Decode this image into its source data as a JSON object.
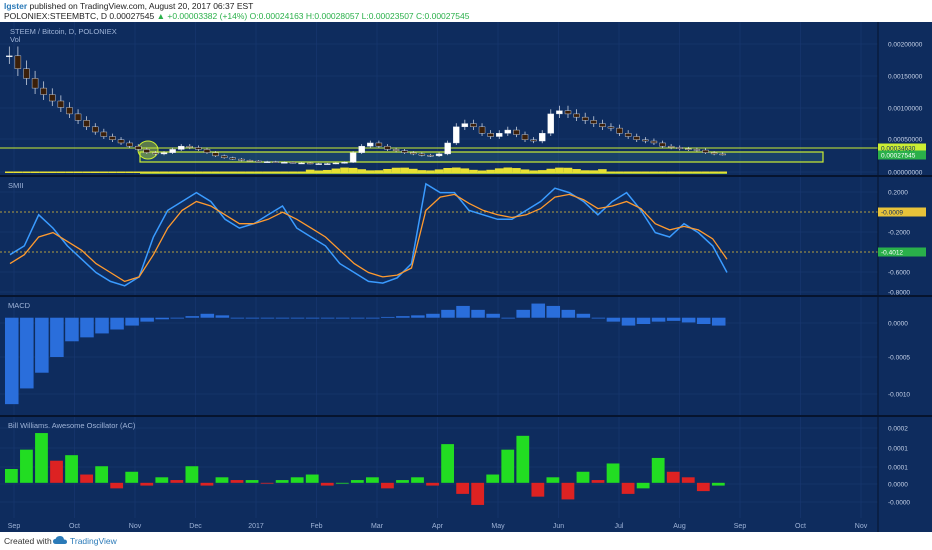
{
  "header": {
    "user": "lgster",
    "published": "published on TradingView.com, August 20, 2017 06:37 EST",
    "symbol_line": "POLONIEX:STEEMBTC, D  0.00027545",
    "change": "▲ +0.00003382 (+14%)",
    "ohlc": "O:0.00024163 H:0.00028057 L:0.00023507 C:0.00027545"
  },
  "footer": {
    "created": "Created with",
    "brand": "TradingView"
  },
  "colors": {
    "background": "#0e2c5e",
    "separator": "#06142e",
    "up": "#ffffff",
    "down": "#3a1f0a",
    "smi": "#3a9bff",
    "signal": "#ff9a2e",
    "macd": "#2a6edb",
    "ao_up": "#22dd22",
    "ao_down": "#dd2222",
    "highlight": "#ccee33",
    "volume": "#e8e033",
    "grid": "#1a3a72"
  },
  "panels": {
    "price": {
      "title": "STEEM / Bitcoin, D, POLONIEX",
      "vol_label": "Vol"
    },
    "smi": {
      "title": "SMII"
    },
    "macd": {
      "title": "MACD"
    },
    "ao": {
      "title": "Bill Williams. Awesome Oscillator (AC)"
    }
  },
  "chart_data": [
    {
      "type": "candlestick",
      "title": "STEEM / Bitcoin, D, POLONIEX",
      "x_ticks": [
        "Sep",
        "Oct",
        "Nov",
        "Dec",
        "2017",
        "Feb",
        "Mar",
        "Apr",
        "May",
        "Jun",
        "Jul",
        "Aug",
        "Sep",
        "Oct",
        "Nov"
      ],
      "y_ticks": [
        "0.00200000",
        "0.00150000",
        "0.00100000",
        "0.00050000",
        "0.00000000"
      ],
      "ylim": [
        0,
        0.0022
      ],
      "price_labels": [
        "0.00034630",
        "0.00027545"
      ],
      "close_series": [
        0.0018,
        0.0016,
        0.00145,
        0.0013,
        0.0012,
        0.0011,
        0.001,
        0.0009,
        0.0008,
        0.0007,
        0.00062,
        0.00055,
        0.0005,
        0.00045,
        0.0004,
        0.00035,
        0.0003,
        0.00028,
        0.0003,
        0.00035,
        0.0004,
        0.00038,
        0.00035,
        0.0003,
        0.00025,
        0.00022,
        0.0002,
        0.00018,
        0.00017,
        0.00016,
        0.00016,
        0.00015,
        0.00015,
        0.00014,
        0.00014,
        0.00013,
        0.00013,
        0.00013,
        0.00014,
        0.00015,
        0.0003,
        0.0004,
        0.00045,
        0.0004,
        0.00035,
        0.00033,
        0.0003,
        0.00028,
        0.00026,
        0.00025,
        0.00028,
        0.00045,
        0.0007,
        0.00075,
        0.0007,
        0.0006,
        0.00055,
        0.0006,
        0.00065,
        0.00058,
        0.0005,
        0.00048,
        0.0006,
        0.0009,
        0.00095,
        0.0009,
        0.00085,
        0.0008,
        0.00075,
        0.0007,
        0.00068,
        0.0006,
        0.00055,
        0.0005,
        0.00048,
        0.00045,
        0.0004,
        0.00038,
        0.00036,
        0.00035,
        0.00034,
        0.0003,
        0.00028,
        0.00027545
      ]
    },
    {
      "type": "line",
      "title": "SMII",
      "y_ticks": [
        "0.2000",
        "-0.2000",
        "-0.6000",
        "-0.8000"
      ],
      "ylim": [
        -0.82,
        0.42
      ],
      "price_labels": [
        "-0.0009",
        "-0.4012"
      ],
      "series": [
        {
          "values": [
            -0.4,
            -0.3,
            0.05,
            -0.1,
            -0.3,
            -0.45,
            -0.6,
            -0.7,
            -0.75,
            -0.65,
            -0.2,
            0.1,
            0.2,
            0.3,
            0.2,
            0.0,
            -0.1,
            -0.05,
            0.05,
            0.15,
            -0.1,
            -0.2,
            -0.3,
            -0.5,
            -0.6,
            -0.7,
            -0.72,
            -0.66,
            -0.5,
            0.4,
            0.3,
            0.3,
            0.1,
            0.05,
            0.0,
            0.0,
            0.1,
            0.2,
            0.35,
            0.3,
            0.2,
            0.05,
            0.2,
            0.3,
            0.1,
            -0.15,
            -0.2,
            -0.05,
            -0.15,
            -0.3,
            -0.6
          ]
        },
        {
          "values": [
            -0.5,
            -0.4,
            -0.2,
            -0.15,
            -0.25,
            -0.35,
            -0.5,
            -0.6,
            -0.7,
            -0.65,
            -0.4,
            -0.1,
            0.1,
            0.2,
            0.15,
            0.05,
            -0.05,
            -0.05,
            0.0,
            0.08,
            0.0,
            -0.1,
            -0.2,
            -0.35,
            -0.5,
            -0.6,
            -0.65,
            -0.63,
            -0.55,
            0.1,
            0.25,
            0.28,
            0.18,
            0.1,
            0.05,
            0.02,
            0.05,
            0.12,
            0.25,
            0.28,
            0.22,
            0.12,
            0.15,
            0.2,
            0.12,
            -0.05,
            -0.12,
            -0.08,
            -0.12,
            -0.22,
            -0.45
          ]
        }
      ]
    },
    {
      "type": "bar",
      "title": "MACD",
      "y_ticks": [
        "0.0000",
        "-0.0005",
        "-0.0010"
      ],
      "ylim": [
        -0.0012,
        0.0002
      ],
      "values": [
        -0.0011,
        -0.0009,
        -0.0007,
        -0.0005,
        -0.0003,
        -0.00025,
        -0.0002,
        -0.00015,
        -0.0001,
        -5e-05,
        -2e-05,
        0.0,
        2e-05,
        5e-05,
        3e-05,
        0.0,
        0.0,
        0.0,
        0.0,
        0.0,
        0.0,
        0.0,
        0.0,
        0.0,
        0.0,
        1e-05,
        2e-05,
        3e-05,
        5e-05,
        0.0001,
        0.00015,
        0.0001,
        5e-05,
        0.0,
        0.0001,
        0.00018,
        0.00015,
        0.0001,
        5e-05,
        0.0,
        -5e-05,
        -0.0001,
        -8e-05,
        -5e-05,
        -4e-05,
        -6e-05,
        -8e-05,
        -0.0001
      ]
    },
    {
      "type": "bar",
      "title": "Bill Williams. Awesome Oscillator (AC)",
      "y_ticks": [
        "0.0002",
        "0.0001",
        "0.0001",
        "0.0000",
        "-0.0000"
      ],
      "ylim": [
        -0.00012,
        0.00022
      ],
      "values": [
        5e-05,
        0.00012,
        0.00018,
        8e-05,
        0.0001,
        3e-05,
        6e-05,
        -2e-05,
        4e-05,
        -1e-05,
        2e-05,
        1e-05,
        6e-05,
        -1e-05,
        2e-05,
        1e-05,
        1e-05,
        0.0,
        1e-05,
        2e-05,
        3e-05,
        -1e-05,
        0.0,
        1e-05,
        2e-05,
        -2e-05,
        1e-05,
        2e-05,
        -1e-05,
        0.00014,
        -4e-05,
        -8e-05,
        3e-05,
        0.00012,
        0.00017,
        -5e-05,
        2e-05,
        -6e-05,
        4e-05,
        1e-05,
        7e-05,
        -4e-05,
        -2e-05,
        9e-05,
        4e-05,
        2e-05,
        -3e-05,
        -1e-05
      ]
    }
  ]
}
